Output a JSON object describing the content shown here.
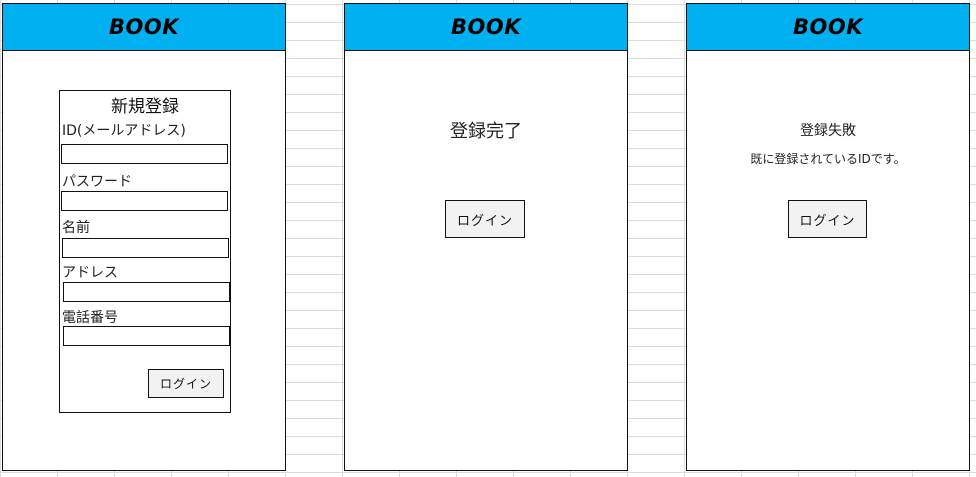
{
  "app": {
    "brand": "BOOK"
  },
  "colors": {
    "header": "#00b0f0",
    "border": "#111111",
    "button_bg": "#f2f2f2"
  },
  "register": {
    "title": "新規登録",
    "fields": [
      {
        "label": "ID(メールアドレス)",
        "value": ""
      },
      {
        "label": "パスワード",
        "value": ""
      },
      {
        "label": "名前",
        "value": ""
      },
      {
        "label": "アドレス",
        "value": ""
      },
      {
        "label": "電話番号",
        "value": ""
      }
    ],
    "button_label": "ログイン"
  },
  "success": {
    "title": "登録完了",
    "button_label": "ログイン"
  },
  "failure": {
    "title": "登録失敗",
    "message": "既に登録されているIDです。",
    "button_label": "ログイン"
  }
}
